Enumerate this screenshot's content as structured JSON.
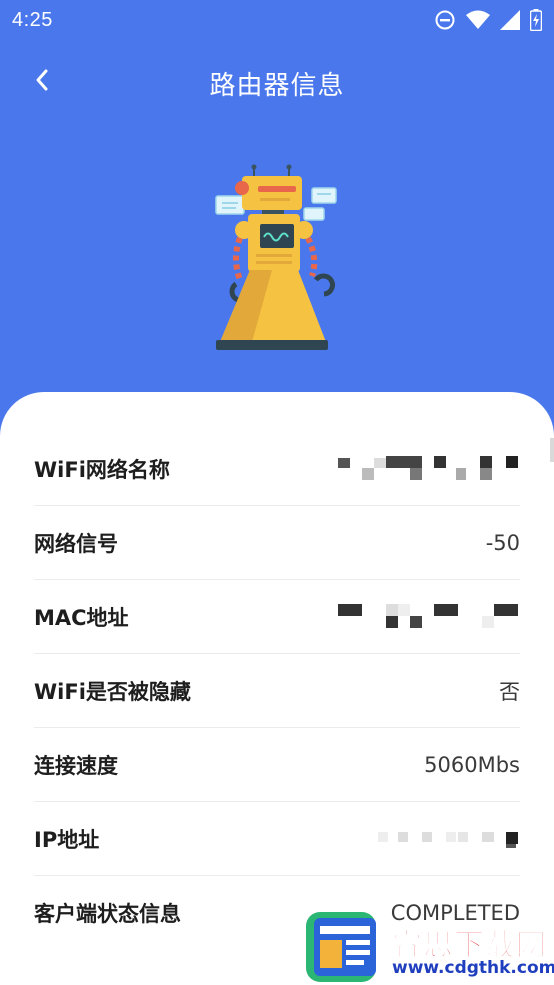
{
  "status_bar": {
    "time": "4:25",
    "icons": [
      "do-not-disturb-icon",
      "wifi-signal-icon",
      "cell-signal-icon",
      "battery-charging-icon"
    ]
  },
  "app_bar": {
    "title": "路由器信息",
    "back_icon": "back-arrow-icon"
  },
  "colors": {
    "header_bg": "#4a78ec",
    "card_bg": "#ffffff",
    "robot_body": "#f5c242",
    "robot_arm_stripe": "#e8674a",
    "divider": "#ececec"
  },
  "router_info": {
    "wifi_name": {
      "label": "WiFi网络名称",
      "value": ""
    },
    "signal": {
      "label": "网络信号",
      "value": "-50"
    },
    "mac": {
      "label": "MAC地址",
      "value": ""
    },
    "hidden": {
      "label": "WiFi是否被隐藏",
      "value": "否"
    },
    "speed": {
      "label": "连接速度",
      "value": "5060Mbs"
    },
    "ip": {
      "label": "IP地址",
      "value": ""
    },
    "client_state": {
      "label": "客户端状态信息",
      "value": "COMPLETED"
    }
  },
  "watermark": {
    "name": "睿思下载网",
    "url": "www.cdgthk.com"
  }
}
